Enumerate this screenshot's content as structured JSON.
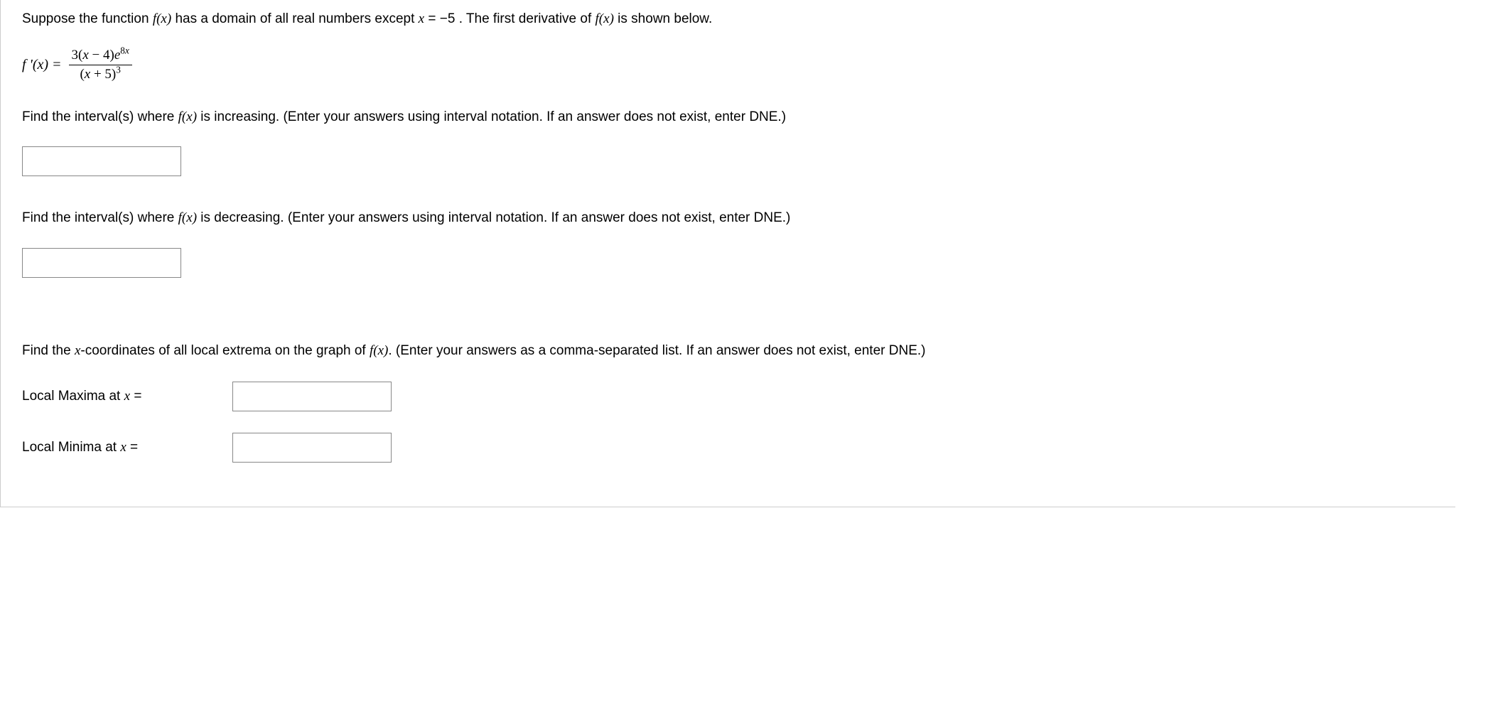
{
  "intro": {
    "text_part1": "Suppose the function ",
    "fx_italic": "f(x)",
    "text_part2": " has a domain of all real numbers except ",
    "x_italic": "x",
    "text_part3": " = −5 . The first derivative of ",
    "fx_italic2": "f(x)",
    "text_part4": " is shown below."
  },
  "formula": {
    "lhs": "f '(x) = ",
    "numerator_plain_before": "3(",
    "numerator_var": "x",
    "numerator_plain_mid": " − 4)",
    "numerator_e": "e",
    "numerator_exp_coeff": "8",
    "numerator_exp_var": "x",
    "denominator_open": "(",
    "denominator_var": "x",
    "denominator_plain": " + 5)",
    "denominator_exp": "3"
  },
  "q_increasing": {
    "prompt_part1": "Find the interval(s) where ",
    "fx_italic": "f(x)",
    "prompt_part2": " is increasing. (Enter your answers using interval notation. If an answer does not exist, enter DNE.)",
    "value": ""
  },
  "q_decreasing": {
    "prompt_part1": "Find the interval(s) where ",
    "fx_italic": "f(x)",
    "prompt_part2": " is decreasing. (Enter your answers using interval notation. If an answer does not exist, enter DNE.)",
    "value": ""
  },
  "q_extrema": {
    "prompt_part1": "Find the ",
    "x_italic": "x",
    "prompt_part2": "-coordinates of all local extrema on the graph of ",
    "fx_italic": "f(x)",
    "prompt_part3": ". (Enter your answers as a comma-separated list. If an answer does not exist, enter DNE.)",
    "maxima_label_part1": "Local Maxima at ",
    "maxima_x": "x",
    "maxima_label_part2": " =",
    "maxima_value": "",
    "minima_label_part1": "Local Minima at ",
    "minima_x": "x",
    "minima_label_part2": " =",
    "minima_value": ""
  }
}
